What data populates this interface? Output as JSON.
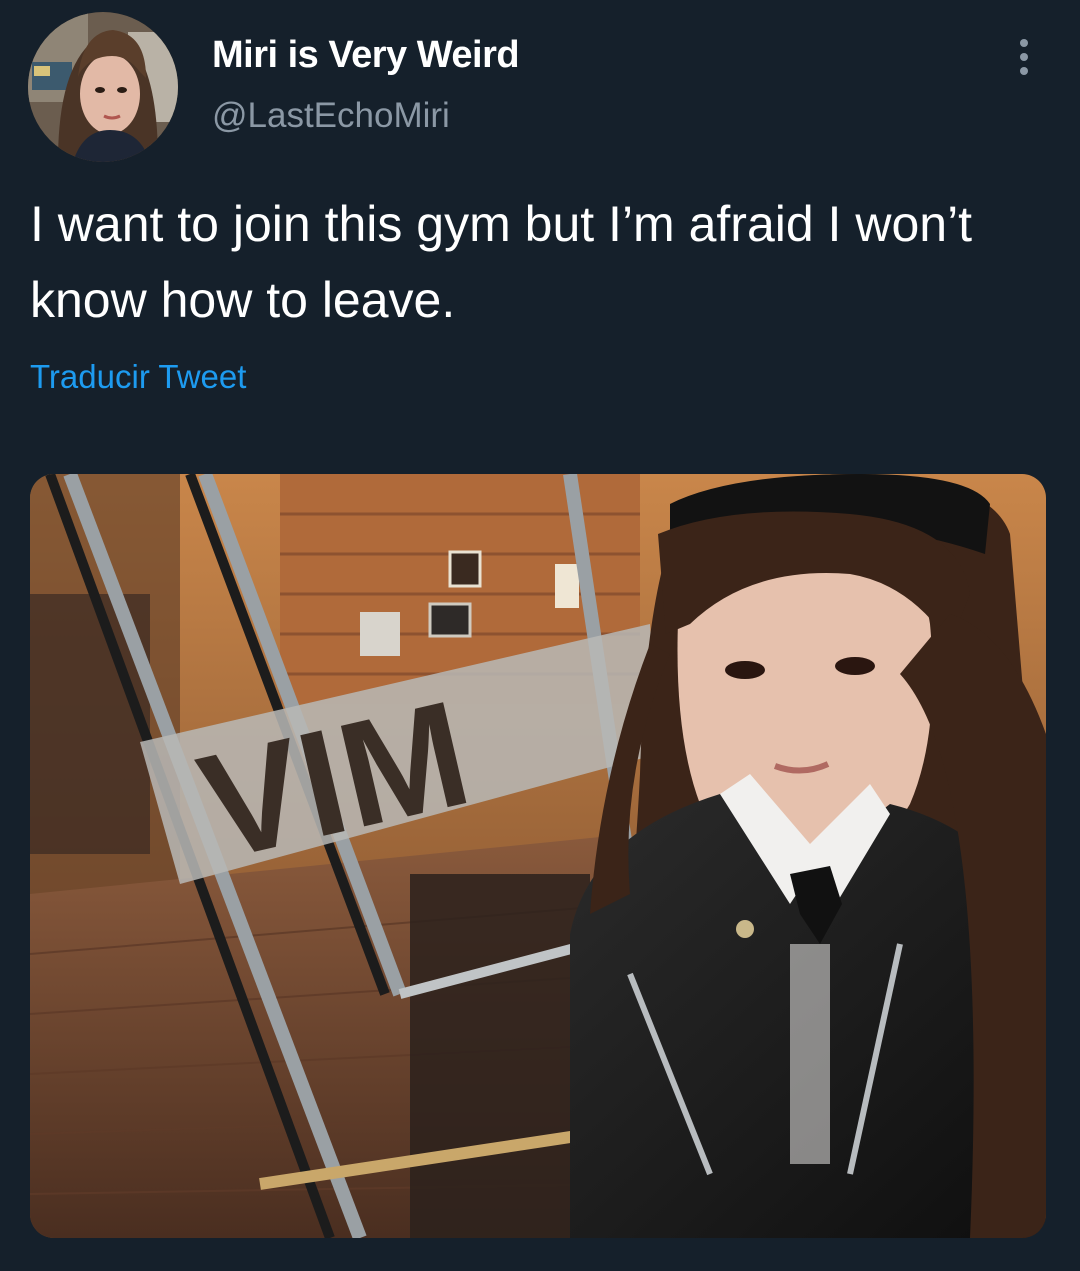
{
  "tweet": {
    "author": {
      "display_name": "Miri is Very Weird",
      "handle": "@LastEchoMiri"
    },
    "text": "I want to join this gym but I’m afraid I won’t know how to leave.",
    "translate_label": "Traducir Tweet",
    "media": {
      "sign_text": "VIM"
    }
  },
  "colors": {
    "background": "#15202b",
    "text": "#ffffff",
    "secondary_text": "#8b98a5",
    "link": "#1d9bf0"
  },
  "icons": {
    "more": "more-options-icon"
  }
}
